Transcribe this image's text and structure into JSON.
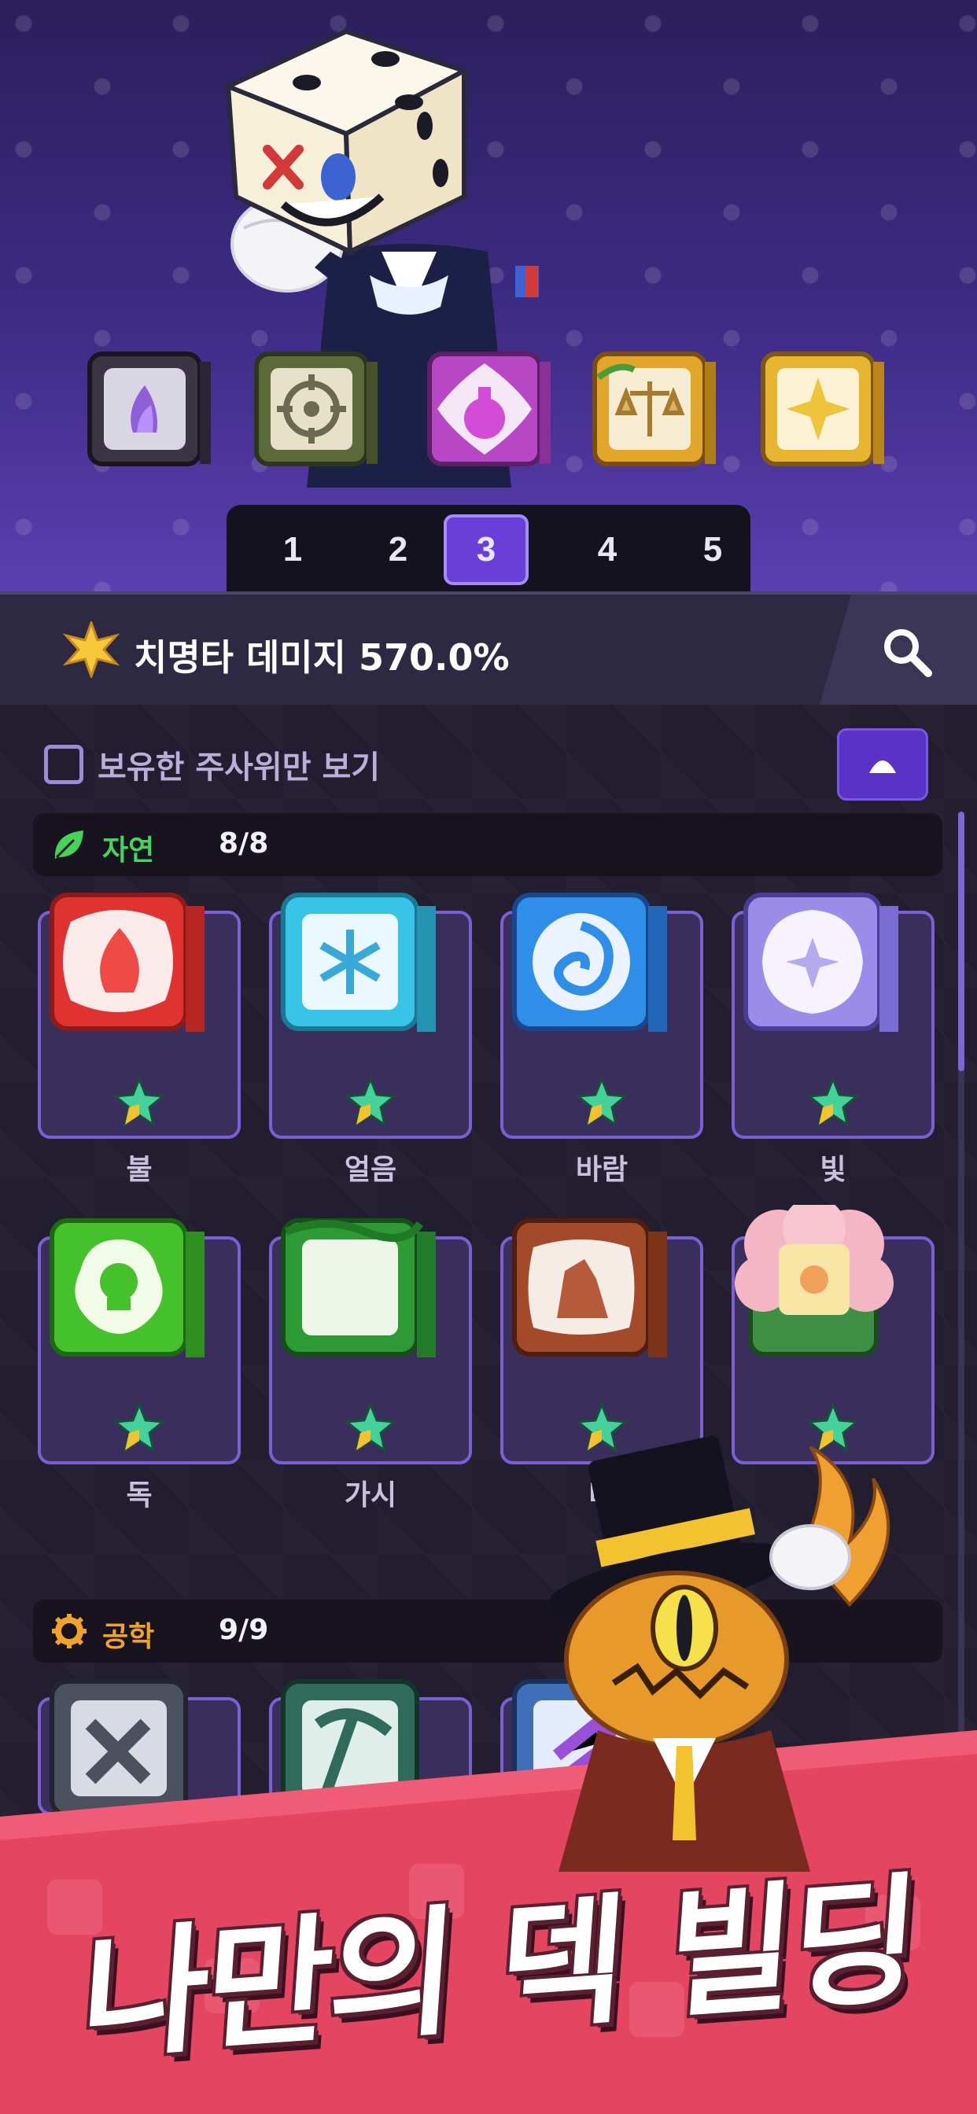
{
  "deck": {
    "slots": [
      "1",
      "2",
      "3",
      "4",
      "5"
    ],
    "active_slot": "3",
    "dice": [
      "mystic-chain",
      "target",
      "potion",
      "justice",
      "sparkle"
    ]
  },
  "stat": {
    "text": "치명타 데미지 570.0%",
    "icon": "star-burst-icon"
  },
  "filter": {
    "owned_only_label": "보유한 주사위만 보기",
    "owned_only_checked": false
  },
  "sections": [
    {
      "title": "자연",
      "count": "8/8",
      "title_color": "#47d35a",
      "icon": "leaf-icon",
      "dice": [
        {
          "name": "불",
          "color": "#e0332f"
        },
        {
          "name": "얼음",
          "color": "#38c4e6"
        },
        {
          "name": "바람",
          "color": "#2f8fe8"
        },
        {
          "name": "빛",
          "color": "#9a8ce8"
        },
        {
          "name": "독",
          "color": "#45c22b"
        },
        {
          "name": "가시",
          "color": "#2e9a35"
        },
        {
          "name": "바",
          "color": "#a24a2a"
        },
        {
          "name": "꽃",
          "color": "#3f8f45"
        }
      ]
    },
    {
      "title": "공학",
      "count": "9/9",
      "title_color": "#f0a32a",
      "icon": "gear-icon"
    }
  ],
  "banner": {
    "title": "나만의 덱 빌딩"
  },
  "colors": {
    "accent": "#6a3fd8",
    "banner": "#e44561"
  }
}
